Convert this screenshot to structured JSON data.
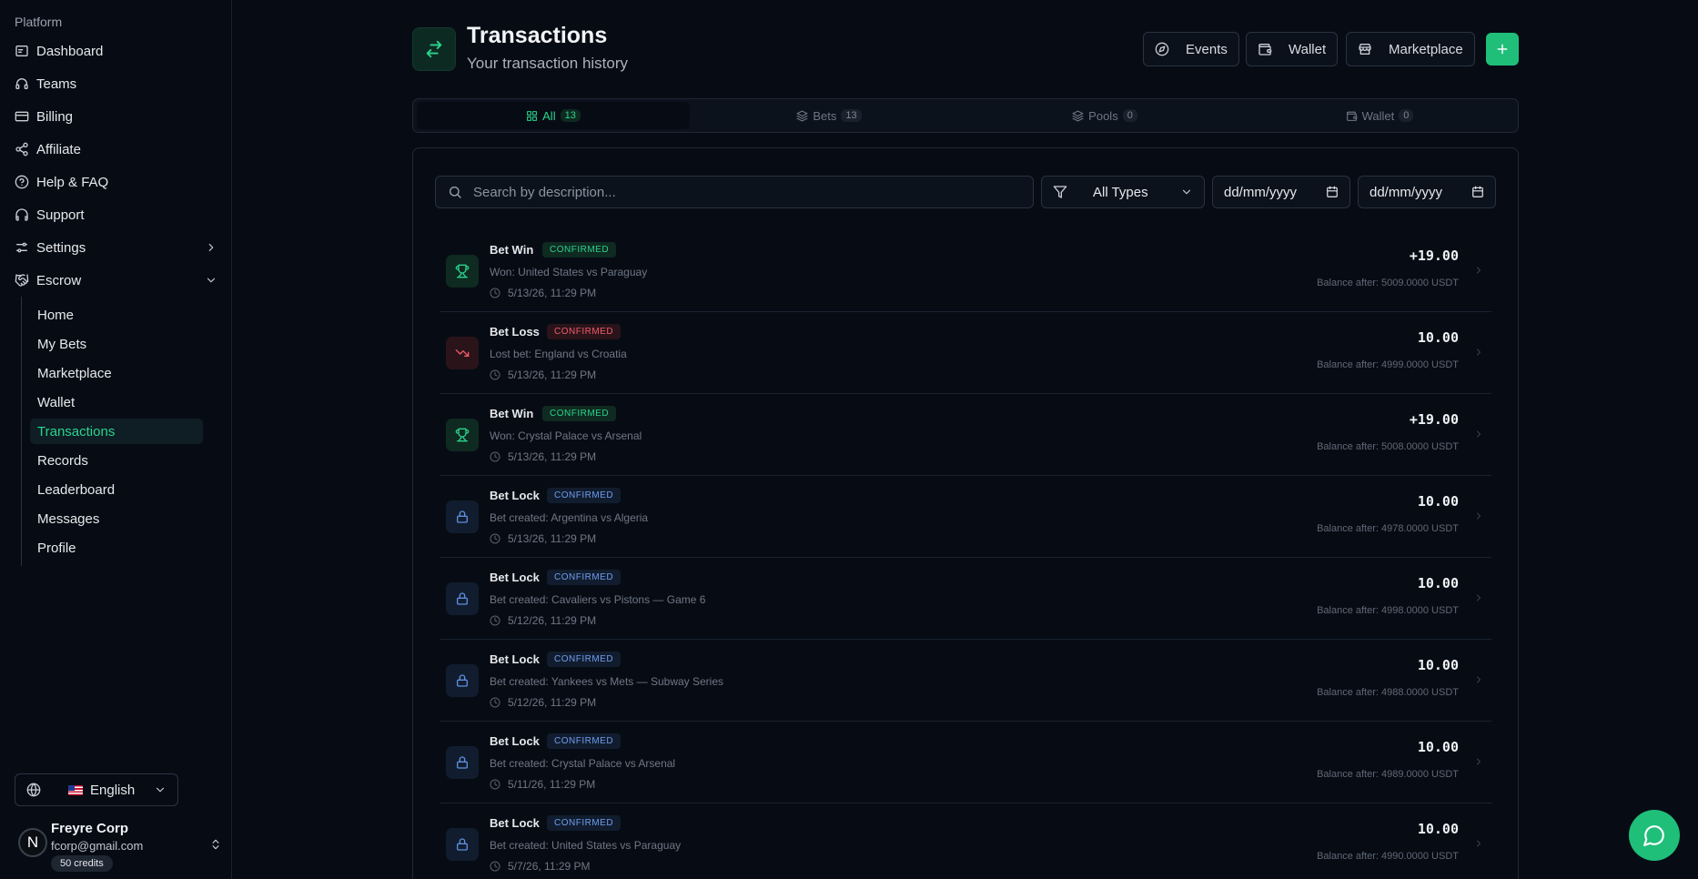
{
  "sidebar": {
    "section": "Platform",
    "items": [
      {
        "label": "Dashboard"
      },
      {
        "label": "Teams"
      },
      {
        "label": "Billing"
      },
      {
        "label": "Affiliate"
      },
      {
        "label": "Help & FAQ"
      },
      {
        "label": "Support"
      },
      {
        "label": "Settings"
      },
      {
        "label": "Escrow"
      }
    ],
    "escrow_items": [
      {
        "label": "Home"
      },
      {
        "label": "My Bets"
      },
      {
        "label": "Marketplace"
      },
      {
        "label": "Wallet"
      },
      {
        "label": "Transactions"
      },
      {
        "label": "Records"
      },
      {
        "label": "Leaderboard"
      },
      {
        "label": "Messages"
      },
      {
        "label": "Profile"
      }
    ],
    "language": "English",
    "user": {
      "initial": "N",
      "name": "Freyre Corp",
      "email": "fcorp@gmail.com",
      "credits": "50 credits"
    }
  },
  "header": {
    "title": "Transactions",
    "subtitle": "Your transaction history",
    "buttons": {
      "events": "Events",
      "wallet": "Wallet",
      "marketplace": "Marketplace"
    }
  },
  "tabs": [
    {
      "label": "All",
      "count": "13"
    },
    {
      "label": "Bets",
      "count": "13"
    },
    {
      "label": "Pools",
      "count": "0"
    },
    {
      "label": "Wallet",
      "count": "0"
    }
  ],
  "filters": {
    "search_placeholder": "Search by description...",
    "type": "All Types",
    "date_from": "dd/mm/yyyy",
    "date_to": "dd/mm/yyyy"
  },
  "transactions": [
    {
      "title": "Bet Win",
      "status": "CONFIRMED",
      "desc": "Won: United States vs Paraguay",
      "time": "5/13/26, 11:29 PM",
      "amount": "+19.00",
      "balance": "Balance after: 5009.0000 USDT"
    },
    {
      "title": "Bet Loss",
      "status": "CONFIRMED",
      "desc": "Lost bet: England vs Croatia",
      "time": "5/13/26, 11:29 PM",
      "amount": "10.00",
      "balance": "Balance after: 4999.0000 USDT"
    },
    {
      "title": "Bet Win",
      "status": "CONFIRMED",
      "desc": "Won: Crystal Palace vs Arsenal",
      "time": "5/13/26, 11:29 PM",
      "amount": "+19.00",
      "balance": "Balance after: 5008.0000 USDT"
    },
    {
      "title": "Bet Lock",
      "status": "CONFIRMED",
      "desc": "Bet created: Argentina vs Algeria",
      "time": "5/13/26, 11:29 PM",
      "amount": "10.00",
      "balance": "Balance after: 4978.0000 USDT"
    },
    {
      "title": "Bet Lock",
      "status": "CONFIRMED",
      "desc": "Bet created: Cavaliers vs Pistons — Game 6",
      "time": "5/12/26, 11:29 PM",
      "amount": "10.00",
      "balance": "Balance after: 4998.0000 USDT"
    },
    {
      "title": "Bet Lock",
      "status": "CONFIRMED",
      "desc": "Bet created: Yankees vs Mets — Subway Series",
      "time": "5/12/26, 11:29 PM",
      "amount": "10.00",
      "balance": "Balance after: 4988.0000 USDT"
    },
    {
      "title": "Bet Lock",
      "status": "CONFIRMED",
      "desc": "Bet created: Crystal Palace vs Arsenal",
      "time": "5/11/26, 11:29 PM",
      "amount": "10.00",
      "balance": "Balance after: 4989.0000 USDT"
    },
    {
      "title": "Bet Lock",
      "status": "CONFIRMED",
      "desc": "Bet created: United States vs Paraguay",
      "time": "5/7/26, 11:29 PM",
      "amount": "10.00",
      "balance": "Balance after: 4990.0000 USDT"
    }
  ],
  "colors": {
    "accent": "#2bd38c",
    "loss": "#f05a6a",
    "lock": "#5f8fe0",
    "background": "#070c14"
  }
}
